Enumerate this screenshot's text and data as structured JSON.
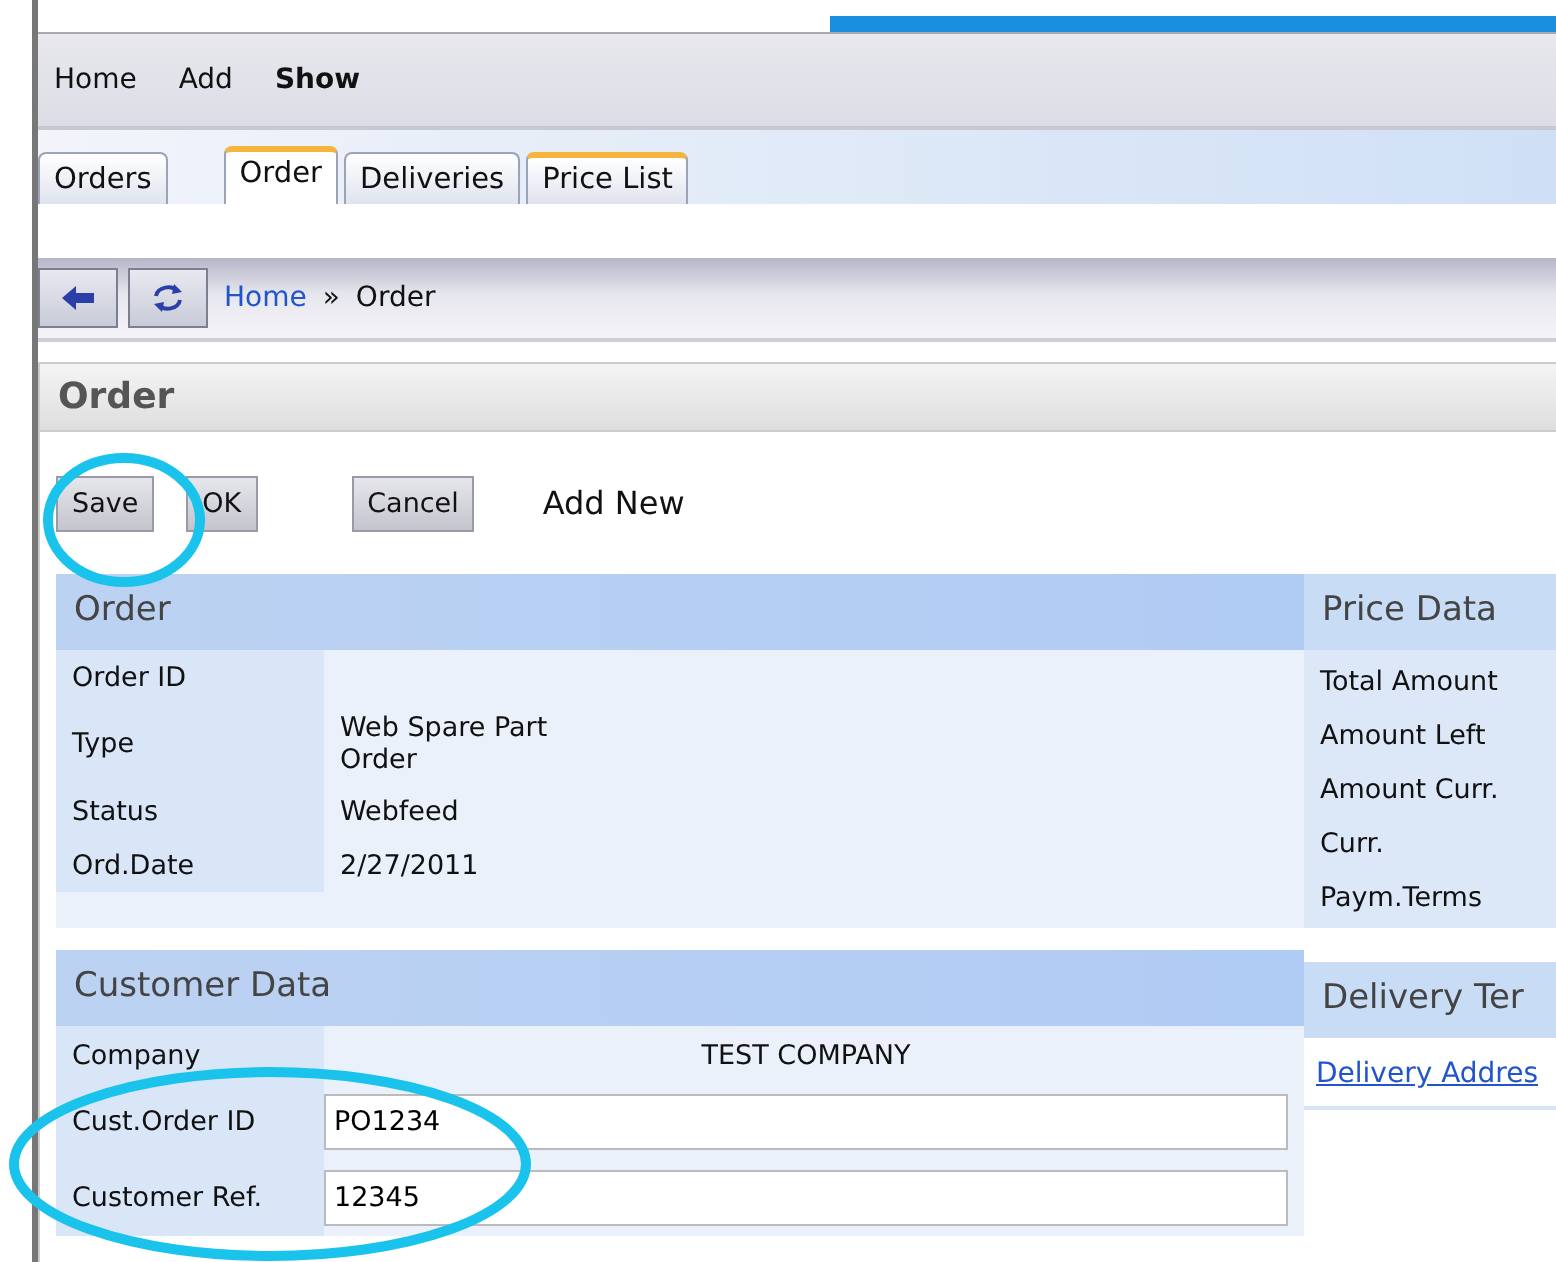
{
  "menu": [
    {
      "label": "Home",
      "selected": false
    },
    {
      "label": "Add",
      "selected": false
    },
    {
      "label": "Show",
      "selected": true
    }
  ],
  "tabs": [
    {
      "label": "Orders",
      "selected": false,
      "accent": false
    },
    {
      "label": "Order",
      "selected": true,
      "accent": true
    },
    {
      "label": "Deliveries",
      "selected": false,
      "accent": false
    },
    {
      "label": "Price List",
      "selected": false,
      "accent": true
    }
  ],
  "breadcrumb": [
    {
      "label": "Home",
      "kind": "link"
    },
    {
      "label": "»",
      "kind": "separator"
    },
    {
      "label": "Order",
      "kind": "current"
    }
  ],
  "panel": {
    "title": "Order",
    "buttons": [
      "Save",
      "OK",
      "Cancel"
    ],
    "add_new": "Add New",
    "order_section": {
      "title": "Order",
      "rows": [
        {
          "label": "Order ID"
        },
        {
          "label": "Type",
          "value": "Web Spare Part\nOrder"
        },
        {
          "label": "Status",
          "value": "Webfeed"
        },
        {
          "label": "Ord.Date",
          "value": "2/27/2011"
        }
      ]
    },
    "price_section": {
      "title": "Price Data",
      "rows": [
        "Total Amount",
        "Amount Left",
        "Amount Curr.",
        "Curr.",
        "Paym.Terms"
      ]
    },
    "customer_section": {
      "title": "Customer Data",
      "company": {
        "label": "Company",
        "value": "TEST COMPANY"
      },
      "fields": [
        {
          "label": "Cust.Order ID",
          "value": "PO1234"
        },
        {
          "label": "Customer Ref.",
          "value": "12345"
        }
      ]
    },
    "delivery_section": {
      "title": "Delivery Ter",
      "link": "Delivery Addres"
    }
  }
}
